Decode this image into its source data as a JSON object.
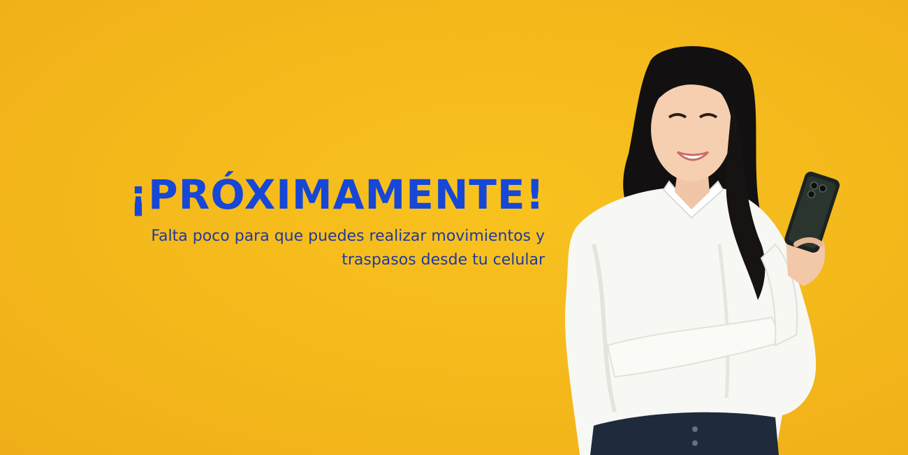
{
  "banner": {
    "headline": "¡PRÓXIMAMENTE!",
    "subtitle_line1": "Falta poco para que puedes realizar movimientos y",
    "subtitle_line2": "traspasos desde tu celular",
    "colors": {
      "background": "#f4b81b",
      "headline": "#1747d6",
      "subtitle": "#1f3a9e"
    },
    "photo": {
      "subject": "woman-holding-phone"
    }
  }
}
